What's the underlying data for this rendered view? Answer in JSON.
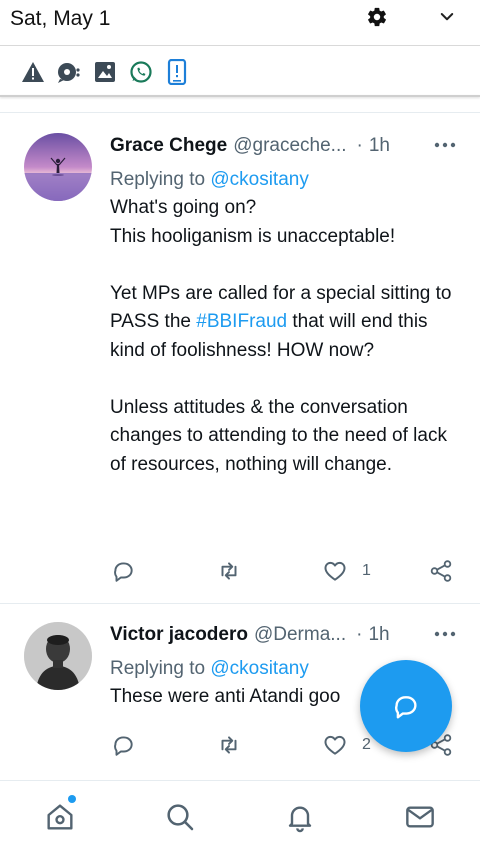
{
  "status_bar": {
    "date": "Sat, May 1",
    "icons": [
      "gear-icon",
      "chevron-down-icon"
    ]
  },
  "notification_icons": [
    "warning-icon",
    "chat-bubble-icon",
    "image-icon",
    "whatsapp-icon",
    "phone-alert-icon"
  ],
  "colors": {
    "accent": "#1d9bf0",
    "text_primary": "#0f1419",
    "text_secondary": "#536471",
    "divider": "#e6ecf0"
  },
  "tweets": [
    {
      "display_name": "Grace Chege",
      "handle": "@graceche...",
      "separator": "·",
      "time": "1h",
      "replying_prefix": "Replying to",
      "replying_to": "@ckositany",
      "text_lines": {
        "p1a": "What's going on?",
        "p1b": "This hooliganism is unacceptable!",
        "p2_pre": "Yet MPs are called for a special sitting to PASS the",
        "p2_hash": "#BBIFraud",
        "p2_post": "that will end this kind of foolishness! HOW now?",
        "p3": "Unless attitudes & the conversation changes to attending to the need of lack of resources, nothing will change."
      },
      "counts": {
        "replies": "",
        "retweets": "",
        "likes": "1"
      }
    },
    {
      "display_name": "Victor jacodero",
      "handle": "@Derma...",
      "separator": "·",
      "time": "1h",
      "replying_prefix": "Replying to",
      "replying_to": "@ckositany",
      "text": "These were anti Atandi goo",
      "counts": {
        "replies": "",
        "retweets": "",
        "likes": "2"
      }
    }
  ],
  "bottom_nav": {
    "items": [
      "home-icon",
      "search-icon",
      "notifications-icon",
      "messages-icon"
    ],
    "home_has_badge": true
  },
  "fab": {
    "icon": "compose-reply-icon"
  }
}
